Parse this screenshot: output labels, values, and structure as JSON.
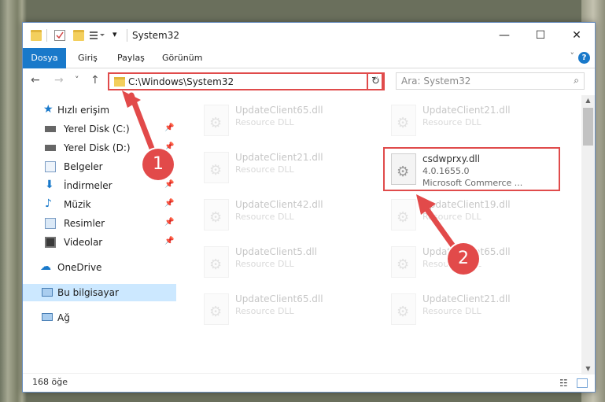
{
  "window": {
    "title": "System32",
    "menu_icon": "menu-dropdown-icon",
    "minimize": "—",
    "maximize": "☐",
    "close": "✕"
  },
  "ribbon": {
    "tabs": [
      "Dosya",
      "Giriş",
      "Paylaş",
      "Görünüm"
    ],
    "help": "?"
  },
  "navbar": {
    "back": "←",
    "forward": "→",
    "recent": "˅",
    "up": "↑",
    "address": "C:\\Windows\\System32",
    "address_dropdown": "˅",
    "refresh": "↻",
    "search_placeholder": "Ara: System32"
  },
  "sidebar": {
    "items": [
      {
        "label": "Hızlı erişim",
        "icon": "star-icon",
        "pinned": false,
        "indent": 0
      },
      {
        "label": "Yerel Disk (C:)",
        "icon": "drive-icon",
        "pinned": true,
        "indent": 1
      },
      {
        "label": "Yerel Disk (D:)",
        "icon": "drive-icon",
        "pinned": true,
        "indent": 1
      },
      {
        "label": "Belgeler",
        "icon": "documents-icon",
        "pinned": true,
        "indent": 1
      },
      {
        "label": "İndirmeler",
        "icon": "download-icon",
        "pinned": true,
        "indent": 1
      },
      {
        "label": "Müzik",
        "icon": "music-icon",
        "pinned": true,
        "indent": 1
      },
      {
        "label": "Resimler",
        "icon": "pictures-icon",
        "pinned": true,
        "indent": 1
      },
      {
        "label": "Videolar",
        "icon": "video-icon",
        "pinned": true,
        "indent": 1
      },
      {
        "label": "OneDrive",
        "icon": "cloud-icon",
        "pinned": false,
        "indent": 0
      },
      {
        "label": "Bu bilgisayar",
        "icon": "computer-icon",
        "pinned": false,
        "indent": 0,
        "selected": true
      },
      {
        "label": "Ağ",
        "icon": "network-icon",
        "pinned": false,
        "indent": 0
      }
    ]
  },
  "files": [
    {
      "name": "UpdateClient65.dll",
      "desc": "Resource DLL",
      "faded": true
    },
    {
      "name": "UpdateClient21.dll",
      "desc": "Resource DLL",
      "faded": true
    },
    {
      "name": "UpdateClient21.dll",
      "desc": "Resource DLL",
      "faded": true
    },
    {
      "name": "csdwprxy.dll",
      "version": "4.0.1655.0",
      "desc": "Microsoft Commerce ...",
      "faded": false,
      "highlighted": true
    },
    {
      "name": "UpdateClient42.dll",
      "desc": "Resource DLL",
      "faded": true
    },
    {
      "name": "UpdateClient19.dll",
      "desc": "Resource DLL",
      "faded": true
    },
    {
      "name": "UpdateClient5.dll",
      "desc": "Resource DLL",
      "faded": true
    },
    {
      "name": "UpdateClient65.dll",
      "desc": "Resource DLL",
      "faded": true
    },
    {
      "name": "UpdateClient65.dll",
      "desc": "Resource DLL",
      "faded": true
    },
    {
      "name": "UpdateClient21.dll",
      "desc": "Resource DLL",
      "faded": true
    }
  ],
  "status": {
    "count": "168 öğe"
  },
  "annotations": {
    "step1": "1",
    "step2": "2",
    "color": "#e24a4a"
  }
}
